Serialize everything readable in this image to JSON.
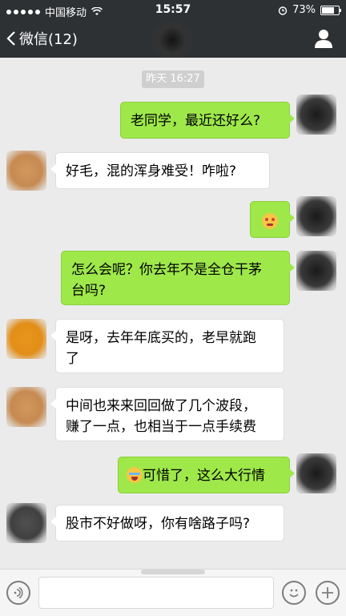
{
  "status_bar": {
    "carrier": "中国移动",
    "time": "15:57",
    "battery": "73%",
    "battery_level": 0.73
  },
  "nav": {
    "back_label": "微信(12)"
  },
  "chat": {
    "timestamp": "昨天 16:27",
    "messages": [
      {
        "from": "me",
        "text": "老同学，最近还好么?"
      },
      {
        "from": "other",
        "text": "好毛，混的浑身难受！咋啦?"
      },
      {
        "from": "me",
        "emoji": "angry-face"
      },
      {
        "from": "me",
        "line1": "怎么会呢？你去年不是全仓干茅",
        "line2": "台吗?"
      },
      {
        "from": "other",
        "line1": "是呀，去年年底买的，老早就跑",
        "line2": "了"
      },
      {
        "from": "other",
        "line1": "中间也来来回回做了几个波段，",
        "line2": "赚了一点，也相当于一点手续费"
      },
      {
        "from": "me",
        "emoji": "crying-face",
        "text": "可惜了，这么大行情"
      },
      {
        "from": "other",
        "text": "股市不好做呀，你有啥路子吗?"
      }
    ]
  },
  "input_bar": {
    "value": ""
  }
}
